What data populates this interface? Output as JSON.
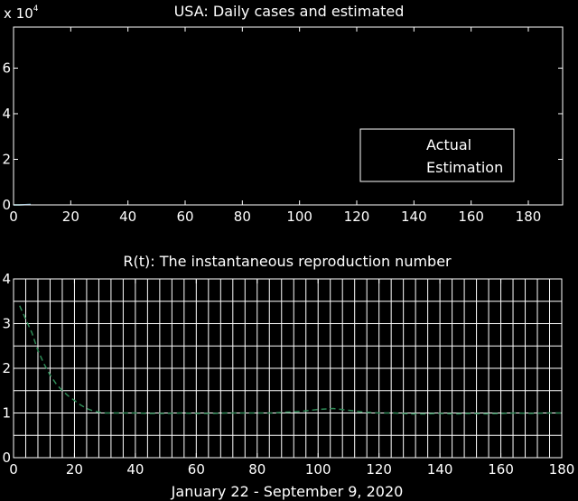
{
  "colors": {
    "background": "#000000",
    "axes": "#ffffff",
    "estimation": "#2e8b57",
    "actual": "#6fa0c8",
    "grid": "#ffffff"
  },
  "chart_data": [
    {
      "type": "line",
      "title": "USA: Daily cases and estimated",
      "xlabel": "",
      "ylabel": "",
      "y_exponent_label": "x 10",
      "y_exponent_power": "4",
      "xlim": [
        0,
        192
      ],
      "ylim": [
        0,
        7.8
      ],
      "x_ticks": [
        0,
        20,
        40,
        60,
        80,
        100,
        120,
        140,
        160,
        180
      ],
      "y_ticks": [
        0,
        2,
        4,
        6
      ],
      "x_tick_labels": [
        "0",
        "20",
        "40",
        "60",
        "80",
        "100",
        "120",
        "140",
        "160",
        "180"
      ],
      "y_tick_labels": [
        "0",
        "2",
        "4",
        "6"
      ],
      "grid": false,
      "legend_position": "right",
      "series": [
        {
          "name": "Actual",
          "x": [
            0,
            2,
            4,
            6
          ],
          "y": [
            0,
            0,
            0.01,
            0.02
          ]
        },
        {
          "name": "Estimation",
          "x": [
            0,
            2,
            4,
            6
          ],
          "y": [
            0,
            0,
            0.01,
            0.02
          ]
        }
      ],
      "legend": [
        "Actual",
        "Estimation"
      ]
    },
    {
      "type": "line",
      "title": "R(t): The instantaneous reproduction number",
      "xlabel": "January 22 - September 9, 2020",
      "ylabel": "",
      "xlim": [
        0,
        180
      ],
      "ylim": [
        0,
        4
      ],
      "x_ticks": [
        0,
        20,
        40,
        60,
        80,
        100,
        120,
        140,
        160,
        180
      ],
      "y_ticks": [
        0,
        1,
        2,
        3,
        4
      ],
      "x_tick_labels": [
        "0",
        "20",
        "40",
        "60",
        "80",
        "100",
        "120",
        "140",
        "160",
        "180"
      ],
      "y_tick_labels": [
        "0",
        "1",
        "2",
        "3",
        "4"
      ],
      "grid": true,
      "grid_x_step": 4,
      "grid_y_step": 0.5,
      "series": [
        {
          "x": [
            2,
            4,
            6,
            8,
            10,
            12,
            14,
            16,
            18,
            20,
            22,
            24,
            26,
            28,
            30,
            35,
            40,
            45,
            50,
            55,
            60,
            65,
            70,
            75,
            80,
            85,
            90,
            95,
            100,
            105,
            110,
            115,
            120,
            125,
            130,
            135,
            140,
            145,
            150,
            155,
            160,
            165,
            170,
            175,
            180
          ],
          "y": [
            3.4,
            3.1,
            2.8,
            2.4,
            2.1,
            1.85,
            1.65,
            1.5,
            1.38,
            1.28,
            1.18,
            1.1,
            1.05,
            1.02,
            1.0,
            1.0,
            1.0,
            0.99,
            0.99,
            1.0,
            0.99,
            0.99,
            1.0,
            1.0,
            1.0,
            1.0,
            1.02,
            1.04,
            1.08,
            1.1,
            1.06,
            1.02,
            1.0,
            1.0,
            0.98,
            0.98,
            0.99,
            0.98,
            0.99,
            0.98,
            0.99,
            1.0,
            0.99,
            1.0,
            1.0
          ]
        }
      ]
    }
  ]
}
